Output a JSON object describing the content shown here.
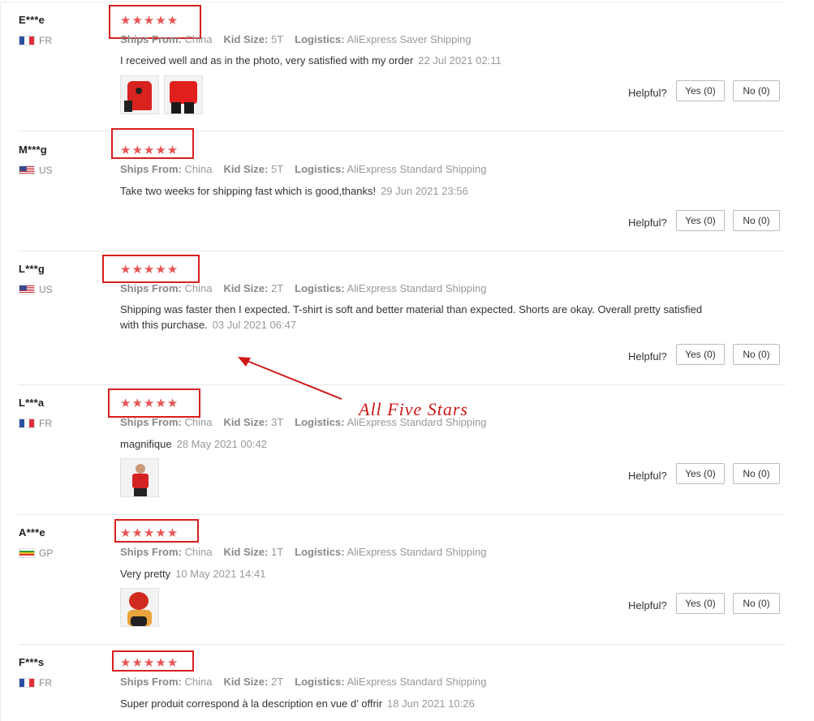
{
  "reviews": [
    {
      "user": "E***e",
      "country": "FR",
      "flag": "fr",
      "stars": "★★★★★",
      "ships_label": "Ships From:",
      "ships_value": "China",
      "size_label": "Kid Size:",
      "size_value": "5T",
      "log_label": "Logistics:",
      "log_value": "AliExpress Saver Shipping",
      "text": "I received well and as in the photo, very satisfied with my order",
      "date": "22 Jul 2021 02:11",
      "photos": 2,
      "helpful": "Helpful?",
      "yes": "Yes (0)",
      "no": "No (0)"
    },
    {
      "user": "M***g",
      "country": "US",
      "flag": "us",
      "stars": "★★★★★",
      "ships_label": "Ships From:",
      "ships_value": "China",
      "size_label": "Kid Size:",
      "size_value": "5T",
      "log_label": "Logistics:",
      "log_value": "AliExpress Standard Shipping",
      "text": "Take two weeks for shipping fast which is good,thanks!",
      "date": "29 Jun 2021 23:56",
      "photos": 0,
      "helpful": "Helpful?",
      "yes": "Yes (0)",
      "no": "No (0)"
    },
    {
      "user": "L***g",
      "country": "US",
      "flag": "us",
      "stars": "★★★★★",
      "ships_label": "Ships From:",
      "ships_value": "China",
      "size_label": "Kid Size:",
      "size_value": "2T",
      "log_label": "Logistics:",
      "log_value": "AliExpress Standard Shipping",
      "text": "Shipping was faster then I expected. T-shirt is soft and better material than expected. Shorts are okay. Overall pretty satisfied with this purchase.",
      "date": "03 Jul 2021 06:47",
      "photos": 0,
      "helpful": "Helpful?",
      "yes": "Yes (0)",
      "no": "No (0)"
    },
    {
      "user": "L***a",
      "country": "FR",
      "flag": "fr",
      "stars": "★★★★★",
      "ships_label": "Ships From:",
      "ships_value": "China",
      "size_label": "Kid Size:",
      "size_value": "3T",
      "log_label": "Logistics:",
      "log_value": "AliExpress Standard Shipping",
      "text": "magnifique",
      "date": "28 May 2021 00:42",
      "photos": 1,
      "helpful": "Helpful?",
      "yes": "Yes (0)",
      "no": "No (0)"
    },
    {
      "user": "A***e",
      "country": "GP",
      "flag": "gp",
      "stars": "★★★★★",
      "ships_label": "Ships From:",
      "ships_value": "China",
      "size_label": "Kid Size:",
      "size_value": "1T",
      "log_label": "Logistics:",
      "log_value": "AliExpress Standard Shipping",
      "text": "Very pretty",
      "date": "10 May 2021 14:41",
      "photos": 1,
      "helpful": "Helpful?",
      "yes": "Yes (0)",
      "no": "No (0)"
    },
    {
      "user": "F***s",
      "country": "FR",
      "flag": "fr",
      "stars": "★★★★★",
      "ships_label": "Ships From:",
      "ships_value": "China",
      "size_label": "Kid Size:",
      "size_value": "2T",
      "log_label": "Logistics:",
      "log_value": "AliExpress Standard Shipping",
      "text": "Super produit correspond à la description en vue d’ offrir",
      "date": "18 Jun 2021 10:26",
      "photos": 0,
      "helpful": "Helpful?",
      "yes": "Yes (0)",
      "no": "No (0)"
    }
  ],
  "annotation": {
    "text": "All Five Stars",
    "color": "#d01818"
  },
  "colors": {
    "star": "#e85454",
    "highlight_box": "#d91f1f"
  }
}
